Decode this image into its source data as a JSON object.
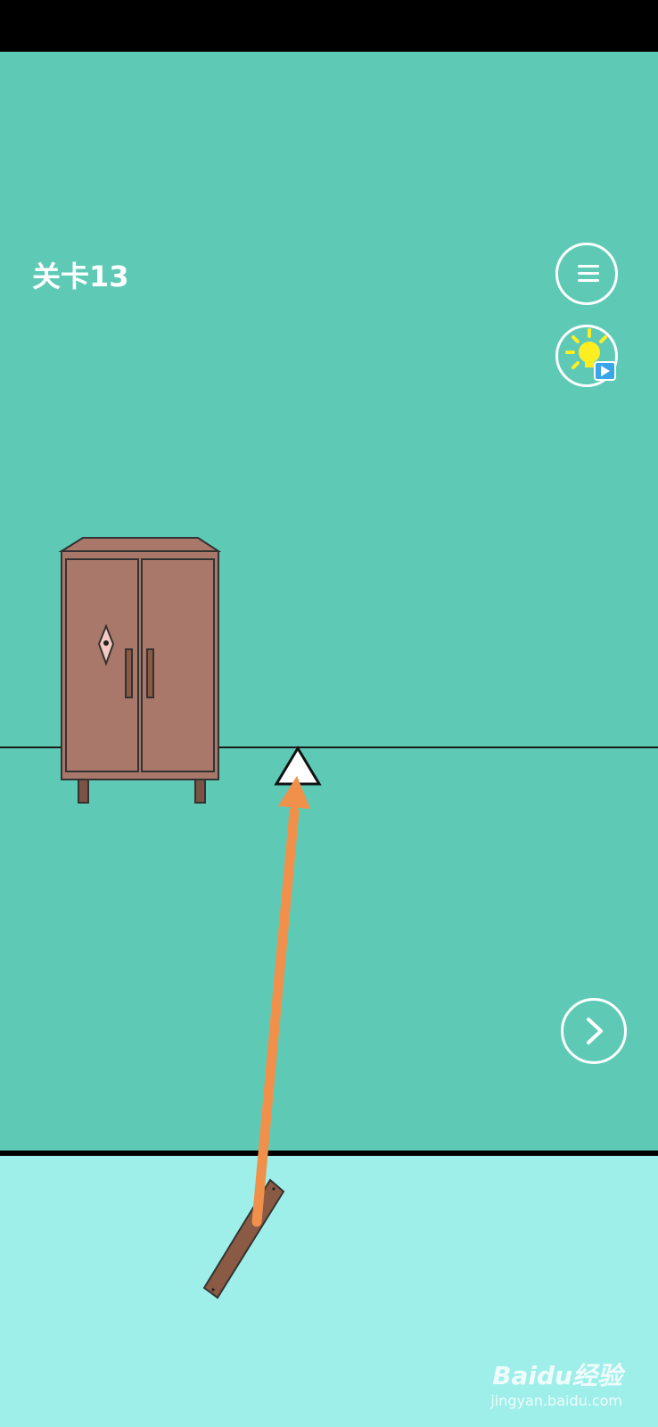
{
  "hud": {
    "level_label": "关卡13",
    "menu_icon": "hamburger-menu-icon",
    "hint_icon": "lightbulb-video-icon",
    "next_icon": "chevron-right-icon"
  },
  "scene": {
    "objects": [
      "cabinet",
      "white-triangle-marker",
      "orange-arrow"
    ],
    "inventory": [
      "wooden-plank"
    ]
  },
  "colors": {
    "wall": "#5ecab6",
    "tray": "#9eefea",
    "cabinet": "#a9786a",
    "arrow": "#f0904a",
    "plank": "#8a5a44",
    "bulb": "#ffee22",
    "video_badge": "#3aa5e8"
  },
  "watermark": {
    "brand": "Baidu经验",
    "url": "jingyan.baidu.com"
  }
}
